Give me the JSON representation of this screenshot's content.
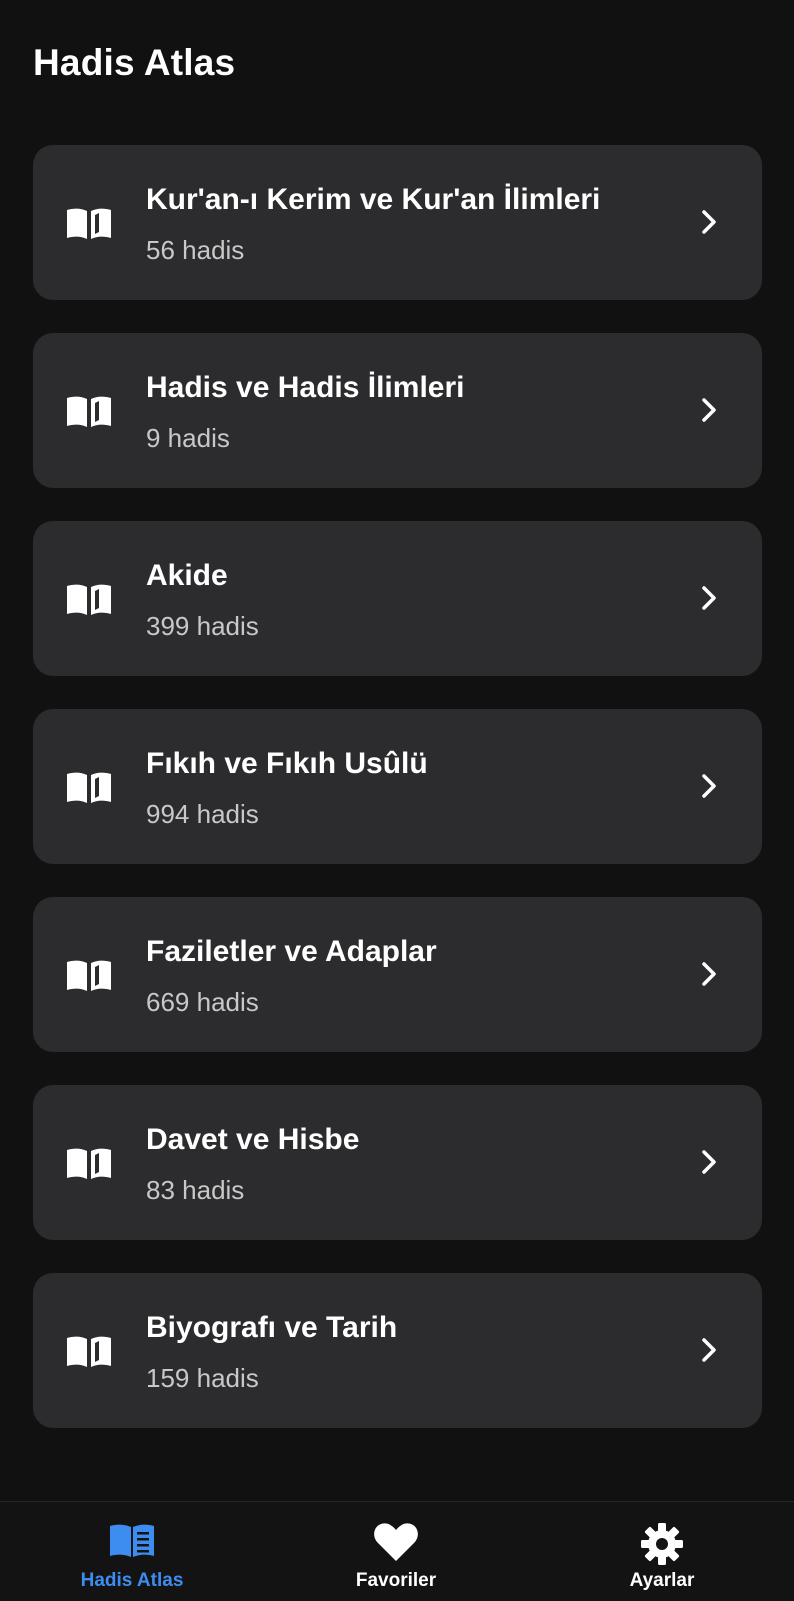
{
  "header": {
    "title": "Hadis Atlas"
  },
  "categories": [
    {
      "title": "Kur'an-ı Kerim ve Kur'an İlimleri",
      "count": "56 hadis",
      "icon": "book-open-icon"
    },
    {
      "title": "Hadis ve Hadis İlimleri",
      "count": "9 hadis",
      "icon": "book-open-icon"
    },
    {
      "title": "Akide",
      "count": "399 hadis",
      "icon": "book-open-icon"
    },
    {
      "title": "Fıkıh ve Fıkıh Usûlü",
      "count": "994 hadis",
      "icon": "book-open-icon"
    },
    {
      "title": "Faziletler ve Adaplar",
      "count": "669 hadis",
      "icon": "book-open-icon"
    },
    {
      "title": "Davet ve Hisbe",
      "count": "83 hadis",
      "icon": "book-open-icon"
    },
    {
      "title": "Biyografı ve Tarih",
      "count": "159 hadis",
      "icon": "book-open-icon"
    }
  ],
  "bottom_nav": {
    "items": [
      {
        "label": "Hadis Atlas",
        "icon": "book-icon",
        "active": true
      },
      {
        "label": "Favoriler",
        "icon": "heart-icon",
        "active": false
      },
      {
        "label": "Ayarlar",
        "icon": "gear-icon",
        "active": false
      }
    ]
  },
  "colors": {
    "background": "#111111",
    "card": "#2c2c2e",
    "accent": "#3d8df0",
    "secondary_text": "#c8c8c8"
  }
}
